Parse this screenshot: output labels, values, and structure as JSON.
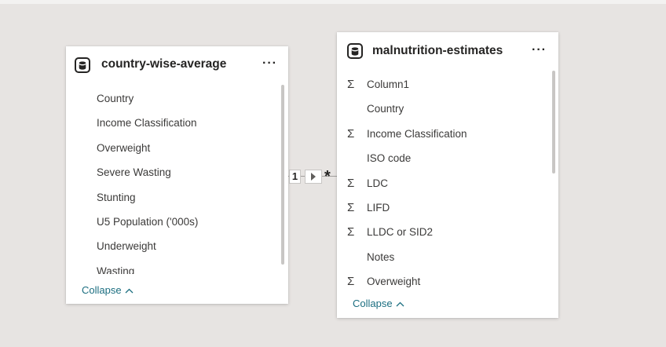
{
  "tables": [
    {
      "title": "country-wise-average",
      "more_label": "···",
      "fields": [
        {
          "name": "Country",
          "sigma": false
        },
        {
          "name": "Income Classification",
          "sigma": false
        },
        {
          "name": "Overweight",
          "sigma": false
        },
        {
          "name": "Severe Wasting",
          "sigma": false
        },
        {
          "name": "Stunting",
          "sigma": false
        },
        {
          "name": "U5 Population ('000s)",
          "sigma": false
        },
        {
          "name": "Underweight",
          "sigma": false
        },
        {
          "name": "Wasting",
          "sigma": false
        }
      ],
      "collapse_label": "Collapse",
      "collapse_icon": "chevron-up-icon"
    },
    {
      "title": "malnutrition-estimates",
      "more_label": "···",
      "fields": [
        {
          "name": "Column1",
          "sigma": true
        },
        {
          "name": "Country",
          "sigma": false
        },
        {
          "name": "Income Classification",
          "sigma": true
        },
        {
          "name": "ISO code",
          "sigma": false
        },
        {
          "name": "LDC",
          "sigma": true
        },
        {
          "name": "LIFD",
          "sigma": true
        },
        {
          "name": "LLDC or SID2",
          "sigma": true
        },
        {
          "name": "Notes",
          "sigma": false
        },
        {
          "name": "Overweight",
          "sigma": true
        }
      ],
      "collapse_label": "Collapse",
      "collapse_icon": "chevron-up-icon"
    }
  ],
  "relationship": {
    "from_cardinality": "1",
    "to_cardinality": "*",
    "direction_icon": "arrow-right-icon"
  },
  "icons": {
    "table": "database-icon",
    "sum": "sigma-icon"
  }
}
